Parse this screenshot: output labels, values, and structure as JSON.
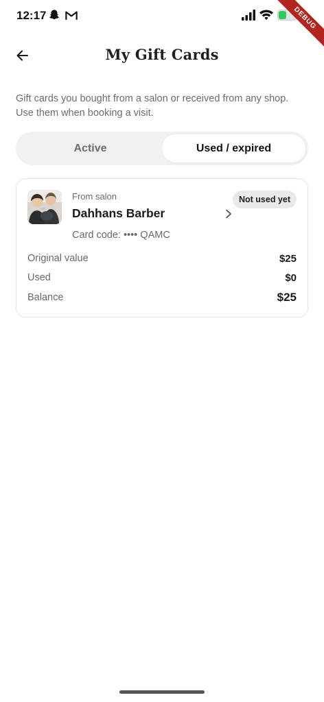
{
  "status_bar": {
    "time": "12:17",
    "debug_label": "DEBUG",
    "icons": [
      "snapchat-icon",
      "gmail-icon",
      "signal-icon",
      "wifi-icon",
      "battery-icon"
    ],
    "battery_color": "#34c759"
  },
  "header": {
    "title": "My Gift Cards",
    "back_icon": "arrow-left-icon"
  },
  "description": "Gift cards you bought from a salon or received from any shop. Use them when booking a visit.",
  "tabs": [
    {
      "label": "Active",
      "selected": false
    },
    {
      "label": "Used / expired",
      "selected": true
    }
  ],
  "gift_card": {
    "from_label": "From salon",
    "salon_name": "Dahhans Barber",
    "status_badge": "Not used yet",
    "card_code": "Card code: •••• QAMC",
    "rows": [
      {
        "label": "Original value",
        "value": "$25"
      },
      {
        "label": "Used",
        "value": "$0"
      },
      {
        "label": "Balance",
        "value": "$25"
      }
    ]
  },
  "colors": {
    "segment_bg": "#f1f1f1",
    "badge_bg": "#e9e9e9",
    "debug_ribbon": "#b3261e"
  }
}
